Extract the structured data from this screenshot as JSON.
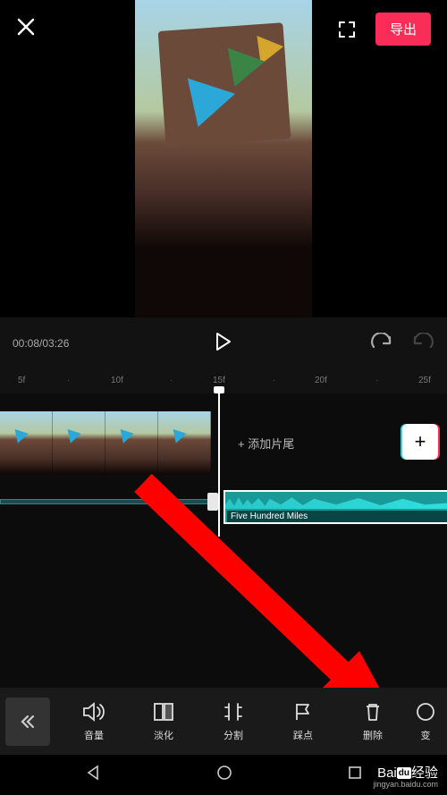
{
  "header": {
    "export_label": "导出"
  },
  "playback": {
    "time_display": "00:08/03:26"
  },
  "ruler": {
    "marks": [
      "5f",
      "10f",
      "15f",
      "20f",
      "25f"
    ]
  },
  "timeline": {
    "add_tail_label": "+ 添加片尾",
    "audio_clip_name": "Five Hundred Miles"
  },
  "toolbar": {
    "items": [
      {
        "id": "volume",
        "label": "音量"
      },
      {
        "id": "fade",
        "label": "淡化"
      },
      {
        "id": "split",
        "label": "分割"
      },
      {
        "id": "beat",
        "label": "踩点"
      },
      {
        "id": "delete",
        "label": "删除"
      },
      {
        "id": "speed",
        "label": "变"
      }
    ]
  },
  "watermark": {
    "brand_prefix": "Bai",
    "brand_box": "du",
    "brand_suffix": "经验",
    "url": "jingyan.baidu.com"
  }
}
